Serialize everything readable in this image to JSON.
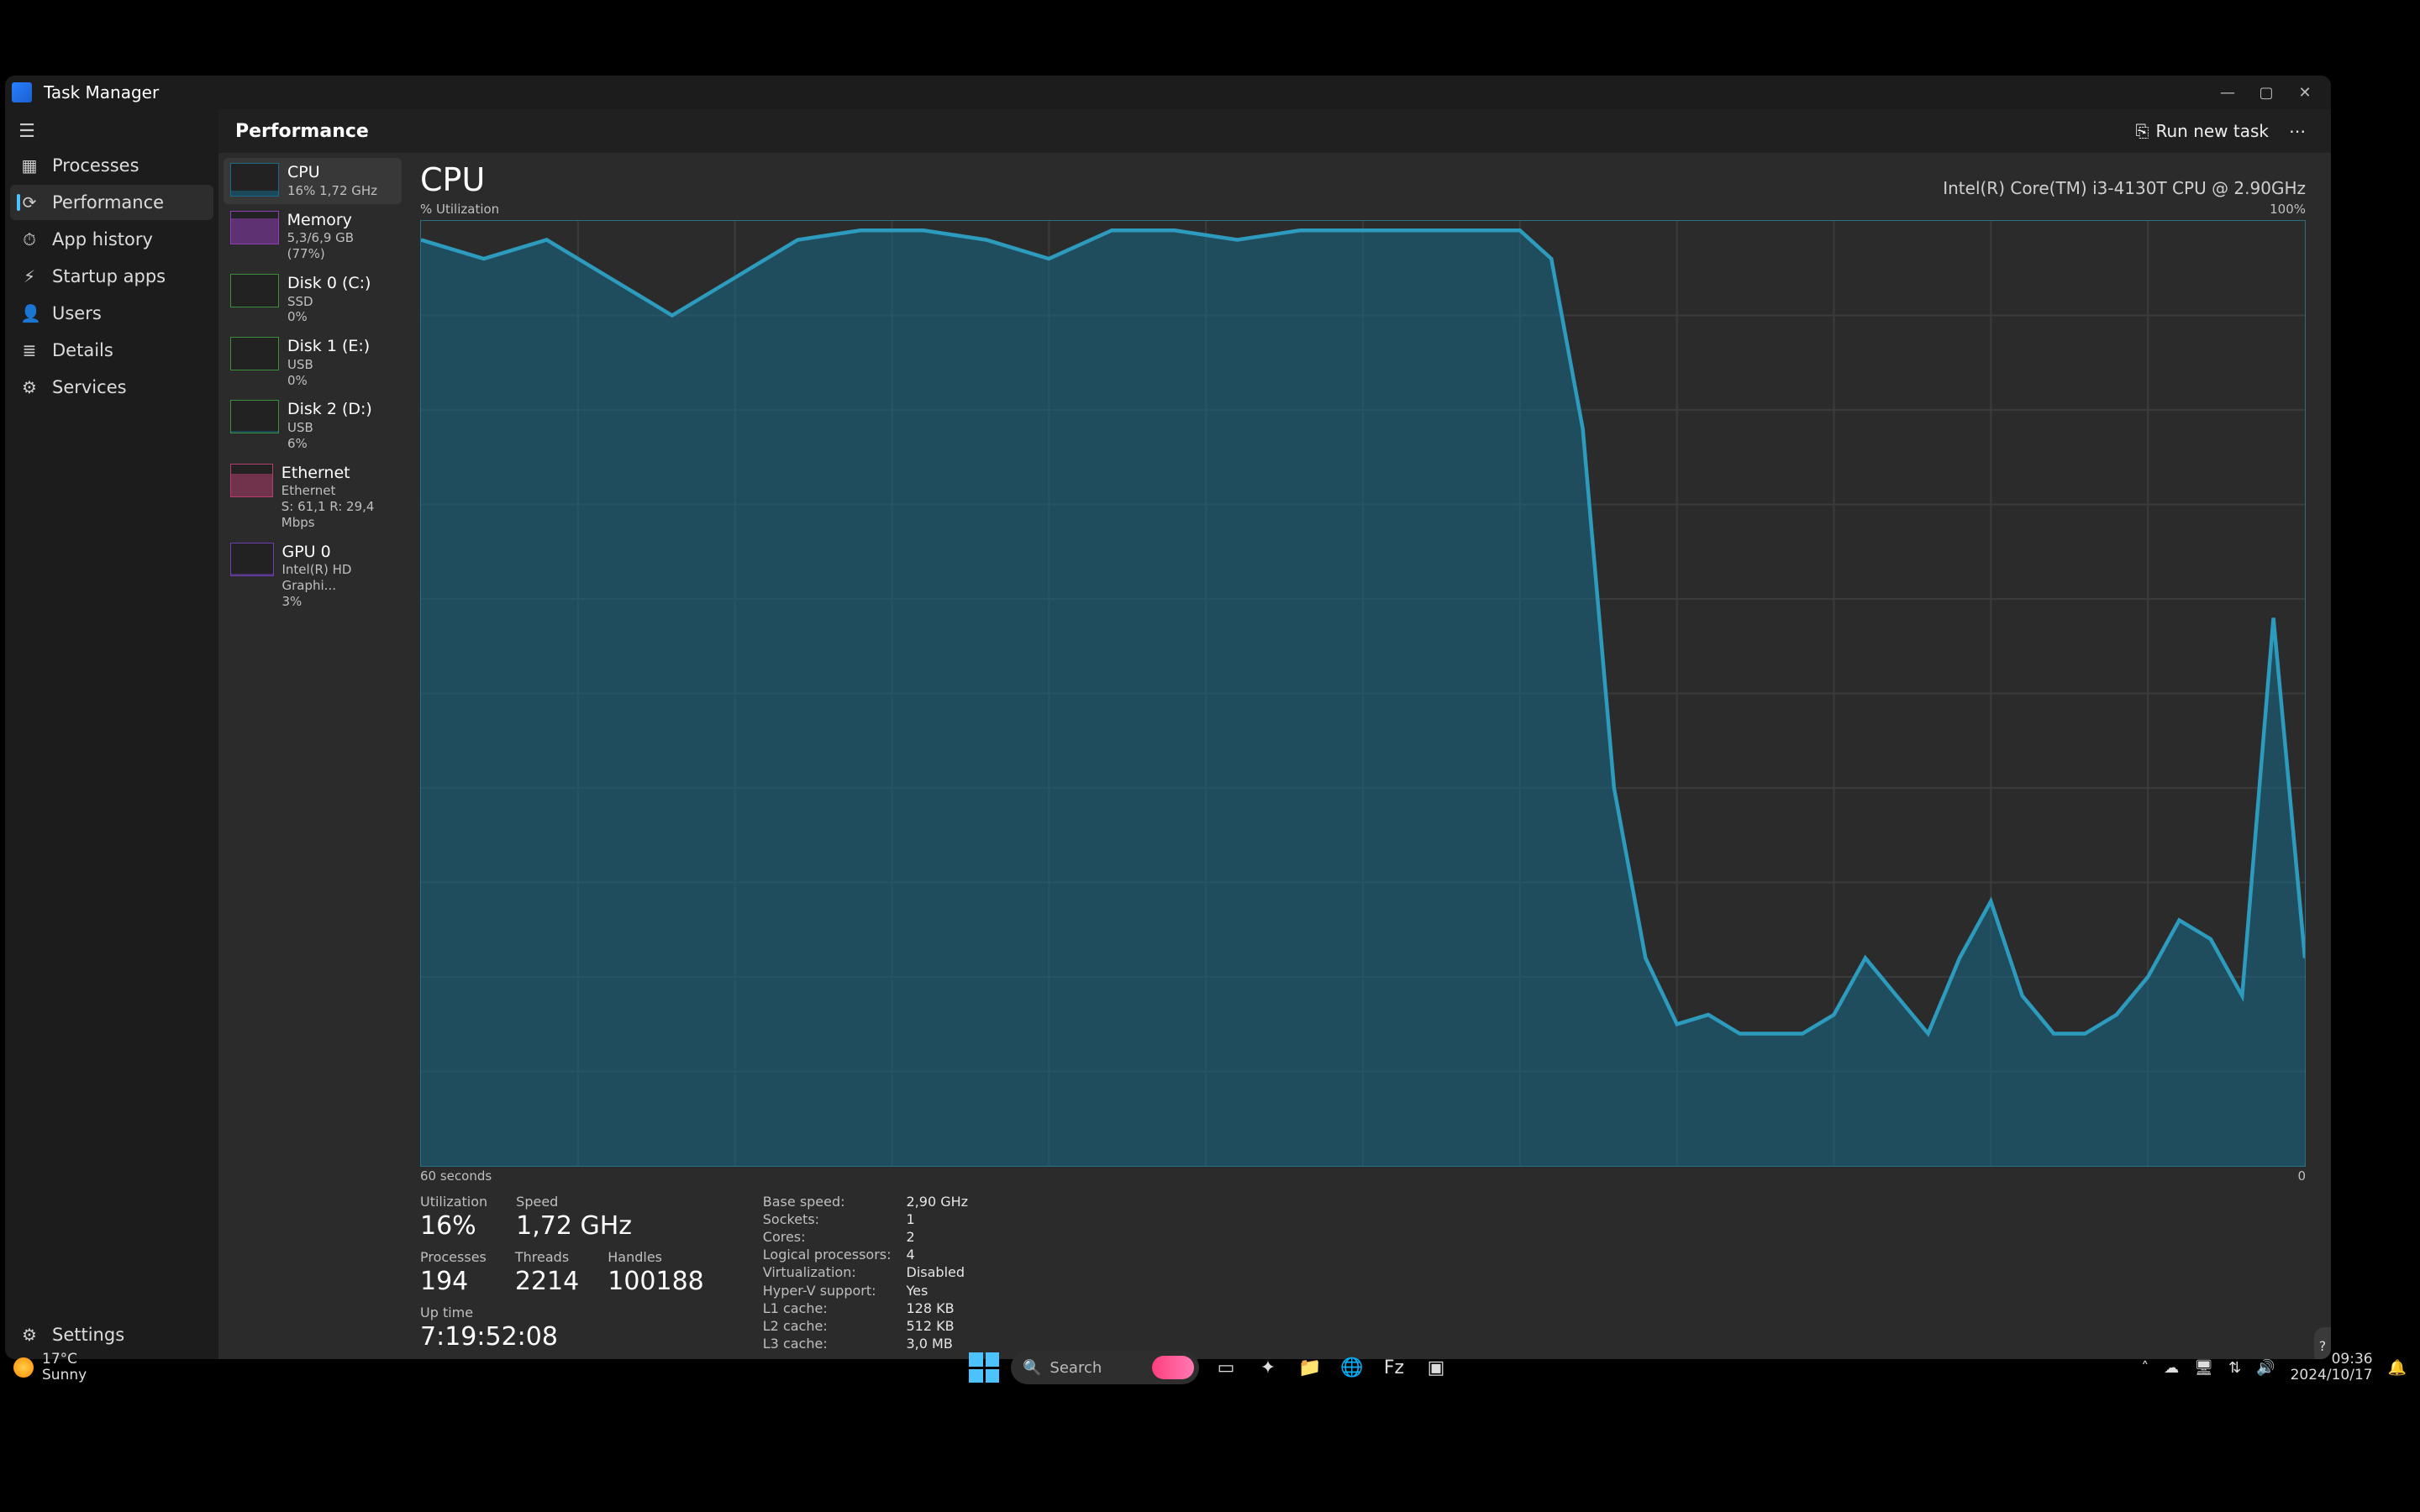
{
  "app": {
    "title": "Task Manager"
  },
  "window_controls": {
    "min": "—",
    "max": "▢",
    "close": "✕"
  },
  "nav": {
    "items": [
      {
        "icon": "▦",
        "label": "Processes",
        "name": "nav-processes"
      },
      {
        "icon": "⟳",
        "label": "Performance",
        "name": "nav-performance",
        "active": true
      },
      {
        "icon": "⏱",
        "label": "App history",
        "name": "nav-app-history"
      },
      {
        "icon": "⚡",
        "label": "Startup apps",
        "name": "nav-startup-apps"
      },
      {
        "icon": "👤",
        "label": "Users",
        "name": "nav-users"
      },
      {
        "icon": "≣",
        "label": "Details",
        "name": "nav-details"
      },
      {
        "icon": "⚙",
        "label": "Services",
        "name": "nav-services"
      }
    ],
    "settings": {
      "icon": "⚙",
      "label": "Settings"
    }
  },
  "subheader": {
    "title": "Performance",
    "run_new_task_icon": "⎘",
    "run_new_task": "Run new task",
    "more_icon": "⋯"
  },
  "perf_list": [
    {
      "id": "cpu",
      "title": "CPU",
      "sub1": "16%  1,72 GHz",
      "thumb_kind": "cpu",
      "fill": 16,
      "active": true
    },
    {
      "id": "mem",
      "title": "Memory",
      "sub1": "5,3/6,9 GB (77%)",
      "thumb_kind": "mem",
      "fill": 77
    },
    {
      "id": "disk0",
      "title": "Disk 0 (C:)",
      "sub1": "SSD",
      "sub2": "0%",
      "thumb_kind": "disk",
      "fill": 0
    },
    {
      "id": "disk1",
      "title": "Disk 1 (E:)",
      "sub1": "USB",
      "sub2": "0%",
      "thumb_kind": "disk",
      "fill": 0
    },
    {
      "id": "disk2",
      "title": "Disk 2 (D:)",
      "sub1": "USB",
      "sub2": "6%",
      "thumb_kind": "disk",
      "fill": 6
    },
    {
      "id": "eth",
      "title": "Ethernet",
      "sub1": "Ethernet",
      "sub2": "S: 61,1 R: 29,4 Mbps",
      "thumb_kind": "net",
      "fill": 70
    },
    {
      "id": "gpu0",
      "title": "GPU 0",
      "sub1": "Intel(R) HD Graphi...",
      "sub2": "3%",
      "thumb_kind": "gpu",
      "fill": 3
    }
  ],
  "cpu": {
    "title": "CPU",
    "model": "Intel(R) Core(TM) i3-4130T CPU @ 2.90GHz",
    "y_label": "% Utilization",
    "y_max": "100%",
    "x_left": "60 seconds",
    "x_right": "0",
    "stats_primary": [
      {
        "label": "Utilization",
        "value": "16%"
      },
      {
        "label": "Speed",
        "value": "1,72 GHz"
      },
      {
        "label": "Processes",
        "value": "194"
      },
      {
        "label": "Threads",
        "value": "2214"
      },
      {
        "label": "Handles",
        "value": "100188"
      },
      {
        "label": "Up time",
        "value": "7:19:52:08"
      }
    ],
    "stats_secondary": [
      {
        "k": "Base speed:",
        "v": "2,90 GHz"
      },
      {
        "k": "Sockets:",
        "v": "1"
      },
      {
        "k": "Cores:",
        "v": "2"
      },
      {
        "k": "Logical processors:",
        "v": "4"
      },
      {
        "k": "Virtualization:",
        "v": "Disabled"
      },
      {
        "k": "Hyper-V support:",
        "v": "Yes"
      },
      {
        "k": "L1 cache:",
        "v": "128 KB"
      },
      {
        "k": "L2 cache:",
        "v": "512 KB"
      },
      {
        "k": "L3 cache:",
        "v": "3,0 MB"
      }
    ]
  },
  "chart_data": {
    "type": "area",
    "xlabel": "seconds ago",
    "ylabel": "% Utilization",
    "xlim_seconds": [
      60,
      0
    ],
    "ylim": [
      0,
      100
    ],
    "grid": true,
    "x": [
      60,
      58,
      56,
      54,
      52,
      50,
      48,
      46,
      44,
      42,
      40,
      38,
      36,
      34,
      32,
      30,
      28,
      26,
      25,
      24,
      23,
      22,
      21,
      20,
      19,
      18,
      17,
      16,
      15,
      14,
      13,
      12,
      11,
      10,
      9,
      8,
      7,
      6,
      5,
      4,
      3,
      2,
      1,
      0
    ],
    "values": [
      98,
      96,
      98,
      94,
      90,
      94,
      98,
      99,
      99,
      98,
      96,
      99,
      99,
      98,
      99,
      99,
      99,
      99,
      99,
      96,
      78,
      40,
      22,
      15,
      16,
      14,
      14,
      14,
      16,
      22,
      18,
      14,
      22,
      28,
      18,
      14,
      14,
      16,
      20,
      26,
      24,
      18,
      58,
      22
    ],
    "series": [
      {
        "name": "CPU % Utilization",
        "color": "#186a86",
        "values": [
          98,
          96,
          98,
          94,
          90,
          94,
          98,
          99,
          99,
          98,
          96,
          99,
          99,
          98,
          99,
          99,
          99,
          99,
          99,
          96,
          78,
          40,
          22,
          15,
          16,
          14,
          14,
          14,
          16,
          22,
          18,
          14,
          22,
          28,
          18,
          14,
          14,
          16,
          20,
          26,
          24,
          18,
          58,
          22
        ]
      }
    ]
  },
  "taskbar": {
    "weather_temp": "17°C",
    "weather_cond": "Sunny",
    "search_placeholder": "Search",
    "icons": [
      {
        "name": "taskview-icon",
        "glyph": "▭"
      },
      {
        "name": "copilot-icon",
        "glyph": "✦"
      },
      {
        "name": "explorer-icon",
        "glyph": "📁"
      },
      {
        "name": "edge-icon",
        "glyph": "🌐"
      },
      {
        "name": "filezilla-icon",
        "glyph": "Fz"
      },
      {
        "name": "taskmgr-icon",
        "glyph": "▣"
      }
    ],
    "tray": {
      "chevron": "˄",
      "onedrive": "☁",
      "display": "🖥",
      "network": "⇅",
      "sound": "🔊",
      "time": "09:36",
      "date": "2024/10/17",
      "notif": "🔔"
    }
  }
}
